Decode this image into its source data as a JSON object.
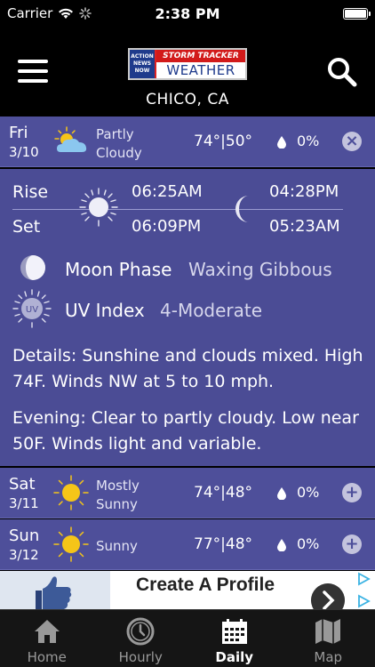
{
  "status_bar": {
    "carrier": "Carrier",
    "time": "2:38 PM"
  },
  "header": {
    "logo": {
      "line1": "ACTION",
      "line2": "NEWS",
      "line3": "NOW",
      "storm": "STORM TRACKER",
      "weather": "WEATHER"
    },
    "location": "CHICO, CA"
  },
  "days": [
    {
      "day": "Fri",
      "date": "3/10",
      "condition": "Partly Cloudy",
      "condition_line1": "Partly",
      "condition_line2": "Cloudy",
      "high": "74°",
      "sep": "|",
      "low": "50°",
      "precip": "0%",
      "icon": "partly-cloudy-icon",
      "toggle": "×"
    },
    {
      "day": "Sat",
      "date": "3/11",
      "condition": "Mostly Sunny",
      "condition_line1": "Mostly",
      "condition_line2": "Sunny",
      "high": "74°",
      "sep": "|",
      "low": "48°",
      "precip": "0%",
      "icon": "sun-icon",
      "toggle": "+"
    },
    {
      "day": "Sun",
      "date": "3/12",
      "condition": "Sunny",
      "condition_line1": "Sunny",
      "condition_line2": "",
      "high": "77°",
      "sep": "|",
      "low": "48°",
      "precip": "0%",
      "icon": "sun-icon",
      "toggle": "+"
    }
  ],
  "details": {
    "rise_label": "Rise",
    "set_label": "Set",
    "sunrise": "06:25AM",
    "sunset": "06:09PM",
    "moonrise": "04:28PM",
    "moonset": "05:23AM",
    "moon_phase_label": "Moon Phase",
    "moon_phase_value": "Waxing Gibbous",
    "uv_badge": "UV",
    "uv_label": "UV Index",
    "uv_value": "4-Moderate",
    "day_text": "Details: Sunshine and clouds mixed. High 74F. Winds NW at 5 to 10 mph.",
    "evening_text": "Evening: Clear to partly cloudy. Low near 50F. Winds light and variable."
  },
  "ad": {
    "text": "Create A Profile"
  },
  "tabs": [
    {
      "label": "Home",
      "icon": "home-icon"
    },
    {
      "label": "Hourly",
      "icon": "clock-icon"
    },
    {
      "label": "Daily",
      "icon": "calendar-icon"
    },
    {
      "label": "Map",
      "icon": "map-icon"
    }
  ],
  "colors": {
    "panel": "#4b4c95",
    "row": "#4e4f9a",
    "sun": "#f5c518",
    "tabbar": "#151515"
  }
}
